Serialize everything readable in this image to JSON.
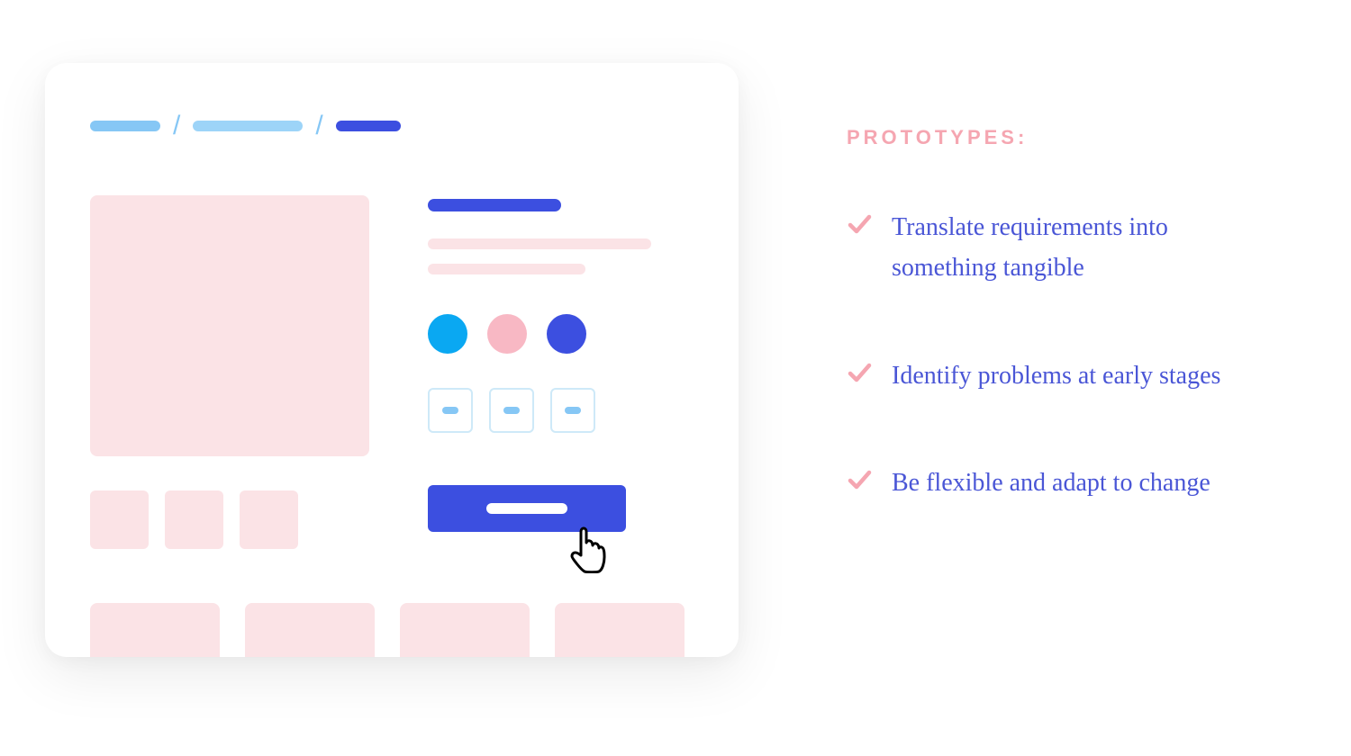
{
  "heading": "PROTOTYPES:",
  "bullets": [
    "Translate requirements into something tangible",
    "Identify problems at early stages",
    "Be flexible and adapt to change"
  ],
  "colors": {
    "pink_light": "#fbe3e6",
    "pink_check": "#f5a6b1",
    "blue_light": "#86c7f5",
    "blue_lighter": "#9dd4f8",
    "blue_dark": "#3c4fe0",
    "cyan": "#0aa8f2",
    "pink_swatch": "#f8b8c4",
    "text_blue": "#4a56d6"
  }
}
